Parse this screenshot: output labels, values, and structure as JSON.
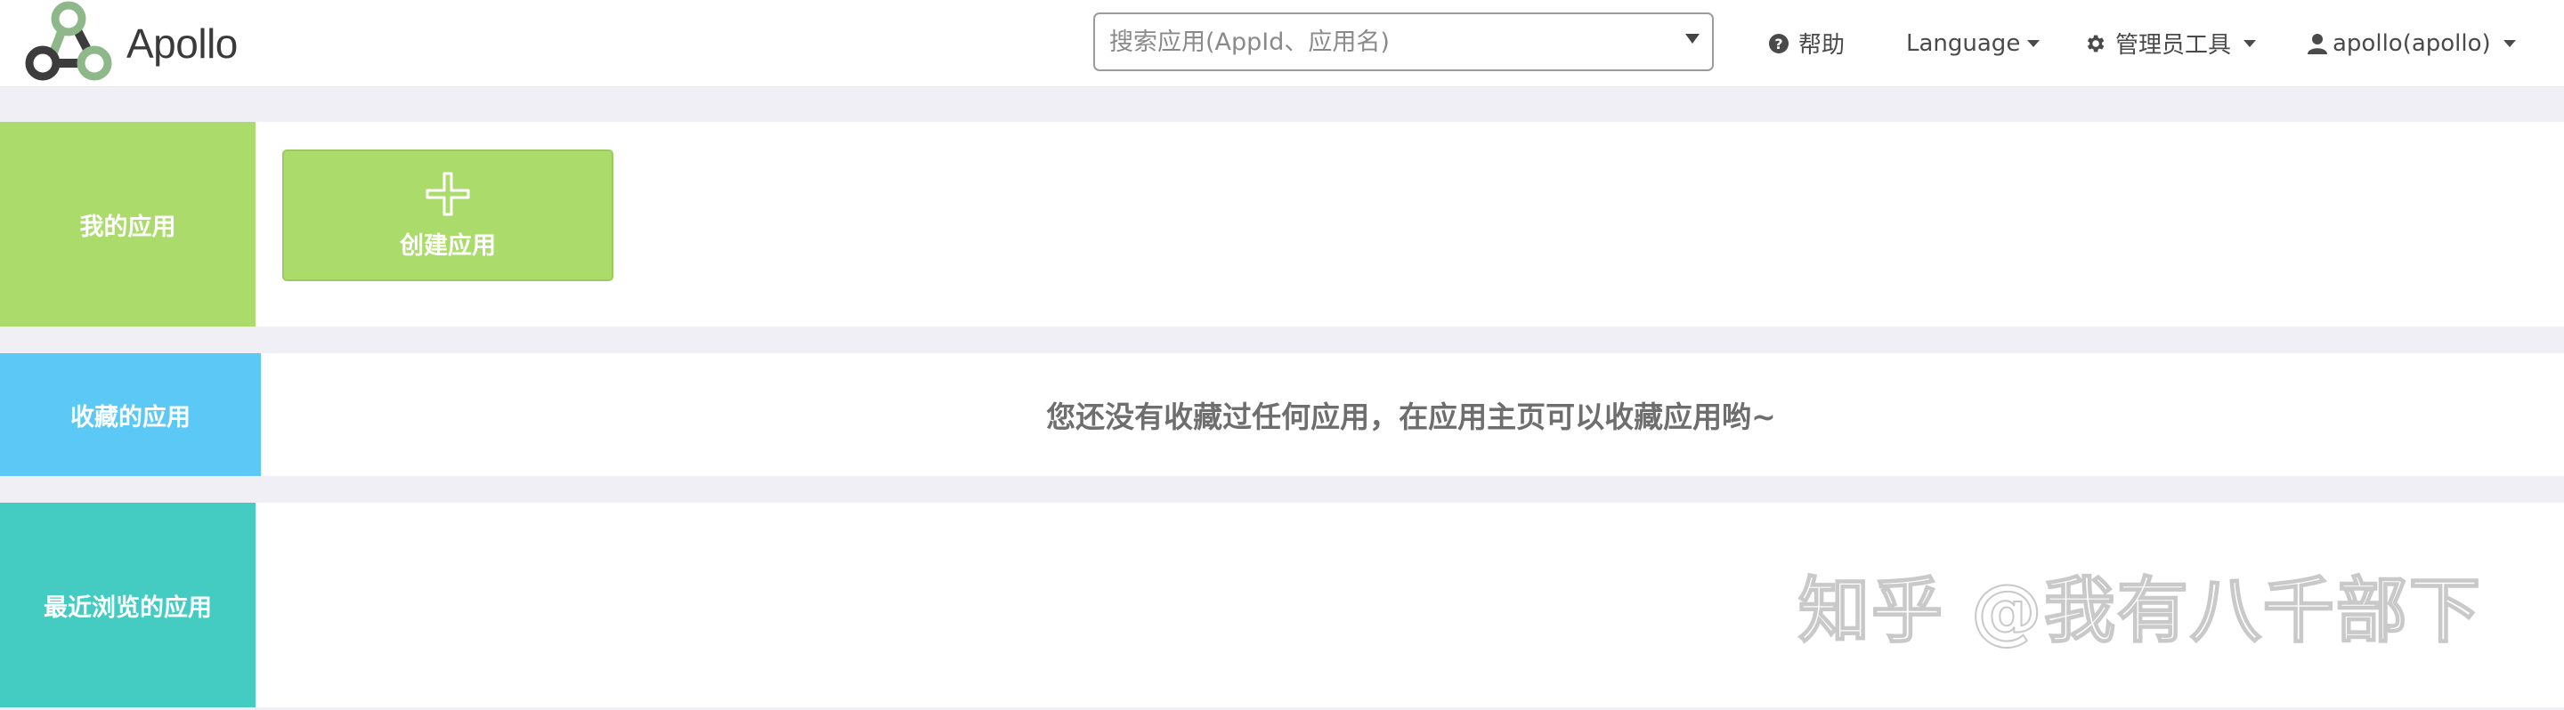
{
  "app": {
    "logo_text": "Apollo"
  },
  "header": {
    "search_placeholder": "搜索应用(AppId、应用名)",
    "help_label": "帮助",
    "language_label": "Language",
    "admin_tools_label": "管理员工具",
    "user_label": "apollo(apollo)"
  },
  "sections": {
    "my_apps": {
      "label": "我的应用",
      "create_label": "创建应用",
      "color": "#abdc6b"
    },
    "favorites": {
      "label": "收藏的应用",
      "empty_message": "您还没有收藏过任何应用，在应用主页可以收藏应用哟~",
      "color": "#5bc8f5"
    },
    "recent": {
      "label": "最近浏览的应用",
      "color": "#45ccc2"
    }
  },
  "watermark": "知乎 @我有八千部下",
  "icons": {
    "logo": "apollo-logo-icon",
    "help": "question-circle-icon",
    "admin": "gear-icon",
    "user": "user-icon",
    "create": "plus-icon",
    "dropdown": "caret-down-icon"
  }
}
